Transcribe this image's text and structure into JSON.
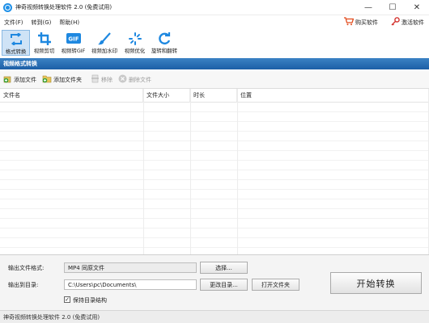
{
  "window": {
    "title": "神奇视频转换处理软件 2.0 (免费试用)",
    "minimize": "—",
    "maximize": "☐",
    "close": "✕"
  },
  "menu": {
    "items": [
      {
        "label": "文件(F)"
      },
      {
        "label": "转到(G)"
      },
      {
        "label": "帮助(H)"
      }
    ],
    "buy_label": "购买软件",
    "activate_label": "激活软件"
  },
  "toolbar": {
    "tools": [
      {
        "label": "格式转换",
        "icon": "convert-icon"
      },
      {
        "label": "视频剪切",
        "icon": "crop-icon"
      },
      {
        "label": "视频转GIF",
        "icon": "gif-icon",
        "icon_text": "GIF"
      },
      {
        "label": "视频加水印",
        "icon": "brush-icon"
      },
      {
        "label": "视频优化",
        "icon": "optimize-icon"
      },
      {
        "label": "旋转和翻转",
        "icon": "rotate-icon"
      }
    ],
    "accent_color": "#1e88e0"
  },
  "section": {
    "title": "视频格式转换"
  },
  "actions": {
    "add_file": "添加文件",
    "add_folder": "添加文件夹",
    "remove": "移除",
    "delete_file": "删除文件"
  },
  "table": {
    "columns": [
      "文件名",
      "文件大小",
      "时长",
      "位置"
    ]
  },
  "output": {
    "format_label": "输出文件格式:",
    "format_value": "MP4 同原文件",
    "select_button": "选择...",
    "dir_label": "输出到目录:",
    "dir_value": "C:\\Users\\pc\\Documents\\",
    "change_dir_button": "更改目录...",
    "open_folder_button": "打开文件夹",
    "keep_structure_label": "保持目录结构",
    "keep_structure_checked": true,
    "check_mark": "✓",
    "start_button": "开始转换"
  },
  "status": {
    "text": "神奇视频转换处理软件 2.0 (免费试用)"
  }
}
